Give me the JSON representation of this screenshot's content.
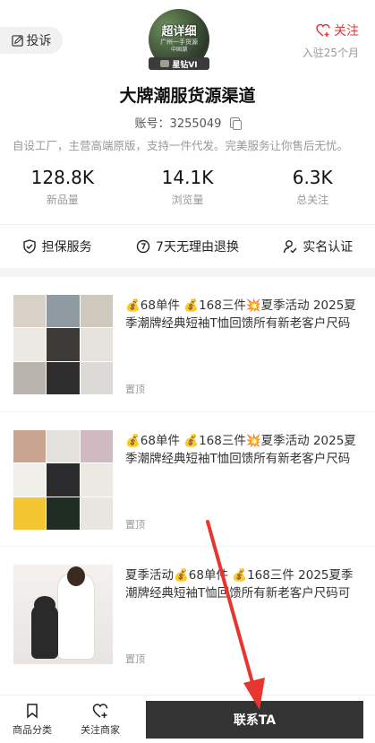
{
  "header": {
    "complain_label": "投诉",
    "follow_label": "关注",
    "joined_text": "入驻25个月",
    "avatar_line1": "超详细",
    "avatar_line2": "广州一手货源",
    "avatar_line3": "中国潮",
    "avatar_badge": "星钻VI",
    "shop_name": "大牌潮服货源渠道",
    "account_text": "账号：3255049",
    "description": "自设工厂，主营高端原版，支持一件代发。完美服务让你售后无忧。"
  },
  "stats": [
    {
      "value": "128.8K",
      "label": "新品量"
    },
    {
      "value": "14.1K",
      "label": "浏览量"
    },
    {
      "value": "6.3K",
      "label": "总关注"
    }
  ],
  "guarantees": [
    {
      "label": "担保服务",
      "icon": "shield-check-icon"
    },
    {
      "label": "7天无理由退换",
      "icon": "seven-day-return-icon"
    },
    {
      "label": "实名认证",
      "icon": "user-verified-icon"
    }
  ],
  "products": [
    {
      "title": "💰68单件 💰168三件💥夏季活动 2025夏季潮牌经典短袖T恤回馈所有新老客户尺码可选 …",
      "tag": "置顶"
    },
    {
      "title": "💰68单件 💰168三件💥夏季活动 2025夏季潮牌经典短袖T恤回馈所有新老客户尺码可选 …",
      "tag": "置顶"
    },
    {
      "title": "夏季活动💰68单件 💰168三件 2025夏季潮牌经典短袖T恤回馈所有新老客户尺码可选 款…",
      "tag": "置顶"
    }
  ],
  "bottom_bar": {
    "category_label": "商品分类",
    "follow_merchant_label": "关注商家",
    "contact_label": "联系TA"
  },
  "colors": {
    "accent_red": "#e4393c",
    "contact_button_bg": "#333333"
  }
}
